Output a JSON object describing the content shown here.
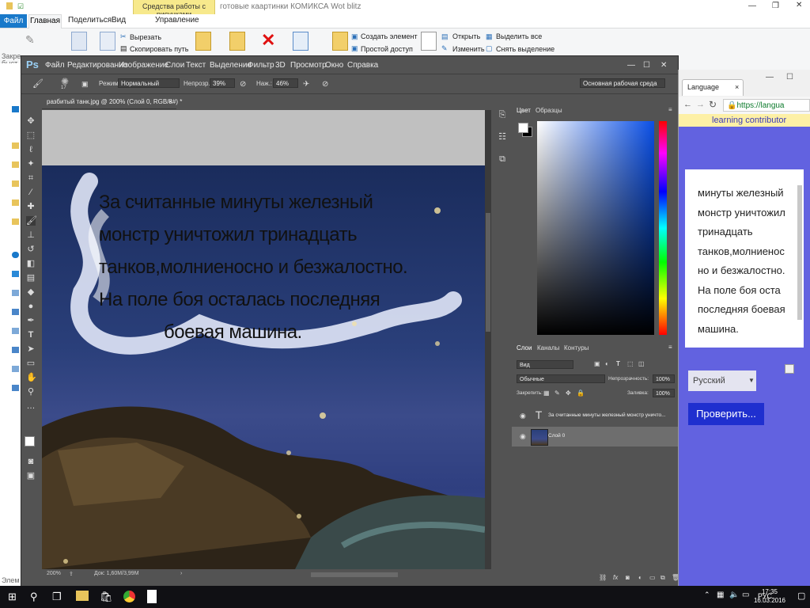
{
  "explorer": {
    "context_tab": "Средства работы с рисунками",
    "title": "готовые каартинки КОМИКСА Wot blitz",
    "tabs": {
      "file": "Файл",
      "home": "Главная",
      "share": "Поделиться",
      "view": "Вид",
      "manage": "Управление"
    },
    "ribbon": {
      "cut": "Вырезать",
      "copy_path": "Скопировать путь",
      "create_element": "Создать элемент",
      "easy_access": "Простой доступ",
      "open": "Открыть",
      "edit": "Изменить",
      "select_all": "Выделить все",
      "deselect": "Снять выделение"
    },
    "side_fragments": [
      "Закре",
      "быст",
      "Элем"
    ]
  },
  "photoshop": {
    "logo": "Ps",
    "menu": [
      "Файл",
      "Редактирование",
      "Изображение",
      "Слои",
      "Текст",
      "Выделение",
      "Фильтр",
      "3D",
      "Просмотр",
      "Окно",
      "Справка"
    ],
    "options": {
      "brush_size": "17",
      "mode_label": "Режим:",
      "mode_value": "Нормальный",
      "opacity_label": "Непрозр.:",
      "opacity_value": "39%",
      "pressure_label": "Наж.:",
      "pressure_value": "46%",
      "workspace": "Основная рабочая среда"
    },
    "document_tab": "разбитый танк.jpg @ 200% (Слой 0, RGB/8#) *",
    "canvas_text": [
      "За считанные минуты железный",
      "монстр уничтожил тринадцать",
      "танков,молниеносно и безжалостно.",
      "На поле боя осталась последняя",
      "боевая машина."
    ],
    "status": {
      "zoom": "200%",
      "doc": "Док: 1,60M/3,99M"
    },
    "color_panel_tabs": [
      "Цвет",
      "Образцы"
    ],
    "layers_panel_tabs": [
      "Слои",
      "Каналы",
      "Контуры"
    ],
    "layers": {
      "filter": "Вид",
      "blend": "Обычные",
      "opacity_label": "Непрозрачность:",
      "opacity_value": "100%",
      "lock_label": "Закрепить:",
      "fill_label": "Заливка:",
      "fill_value": "100%",
      "items": [
        {
          "name": "За считанные минуты железный монстр уничто...",
          "type": "T"
        },
        {
          "name": "Слой 0",
          "type": "image"
        }
      ]
    },
    "accent_color": "#0a4fe6"
  },
  "browser": {
    "tab_title": "Language",
    "url": "https://langua",
    "contributor": "learning contributor",
    "card_text": [
      "минуты железный",
      "монстр уничтожил",
      "тринадцать",
      "танков,молниенос",
      "но и безжалостно.",
      "На поле боя оста",
      "последняя боевая",
      "машина."
    ],
    "language_select": "Русский",
    "check_button": "Проверить...",
    "page_color": "#6262e0"
  },
  "taskbar": {
    "lang": "РУС",
    "time": "17:35",
    "date": "16.03.2016"
  }
}
